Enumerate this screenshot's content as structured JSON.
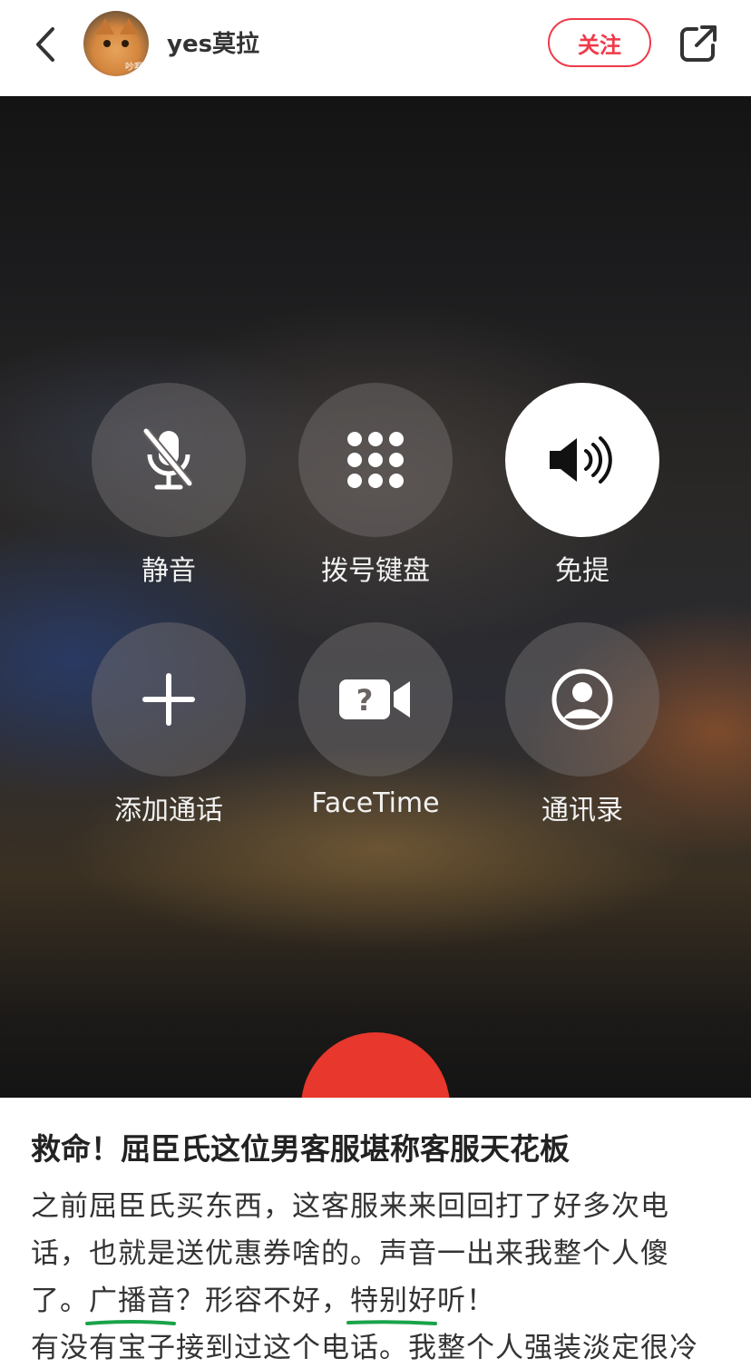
{
  "header": {
    "author_name": "yes莫拉",
    "avatar_text": "吵啊",
    "follow_label": "关注"
  },
  "call_screen": {
    "buttons": [
      {
        "label": "静音",
        "icon": "mic-mute-icon",
        "active": false
      },
      {
        "label": "拨号键盘",
        "icon": "keypad-icon",
        "active": false
      },
      {
        "label": "免提",
        "icon": "speaker-icon",
        "active": true
      },
      {
        "label": "添加通话",
        "icon": "plus-icon",
        "active": false
      },
      {
        "label": "FaceTime",
        "icon": "facetime-icon",
        "active": false
      },
      {
        "label": "通讯录",
        "icon": "contacts-icon",
        "active": false
      }
    ],
    "end_call_color": "#e8372c"
  },
  "post": {
    "title": "救命！屈臣氏这位男客服堪称客服天花板",
    "line1": "之前屈臣氏买东西，这客服来来回回打了好多次电",
    "line2": "话，也就是送优惠券啥的。声音一出来我整个人傻",
    "line3_a": "了。",
    "line3_mark1": "广播音？",
    "line3_b": "形容不好，",
    "line3_mark2": "特别好听！",
    "line4": "有没有宝子接到过这个电话。我整个人强装淡定很冷"
  },
  "colors": {
    "accent": "#ef3a4a",
    "underline": "#1aa34a",
    "end_call": "#e8372c"
  }
}
